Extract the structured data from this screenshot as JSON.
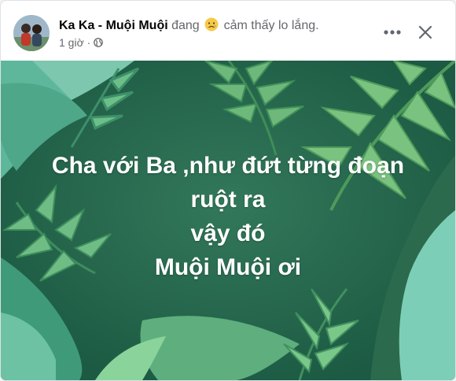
{
  "post": {
    "author": "Ka Ka - Muội Muội",
    "status_prefix": "đang",
    "feeling_text": "cảm thấy lo lắng.",
    "feeling_icon": "worried-face-icon",
    "time": "1 giờ",
    "separator": "·",
    "privacy_icon": "globe-icon",
    "lines": [
      "Cha với Ba ,như đứt từng đoạn",
      "ruột ra",
      "vậy đó",
      "Muội Muội ơi"
    ],
    "background_color": "#2a6b50",
    "text_color": "#ffffff"
  },
  "header": {
    "more_icon": "more-horizontal-icon",
    "close_icon": "close-icon"
  }
}
